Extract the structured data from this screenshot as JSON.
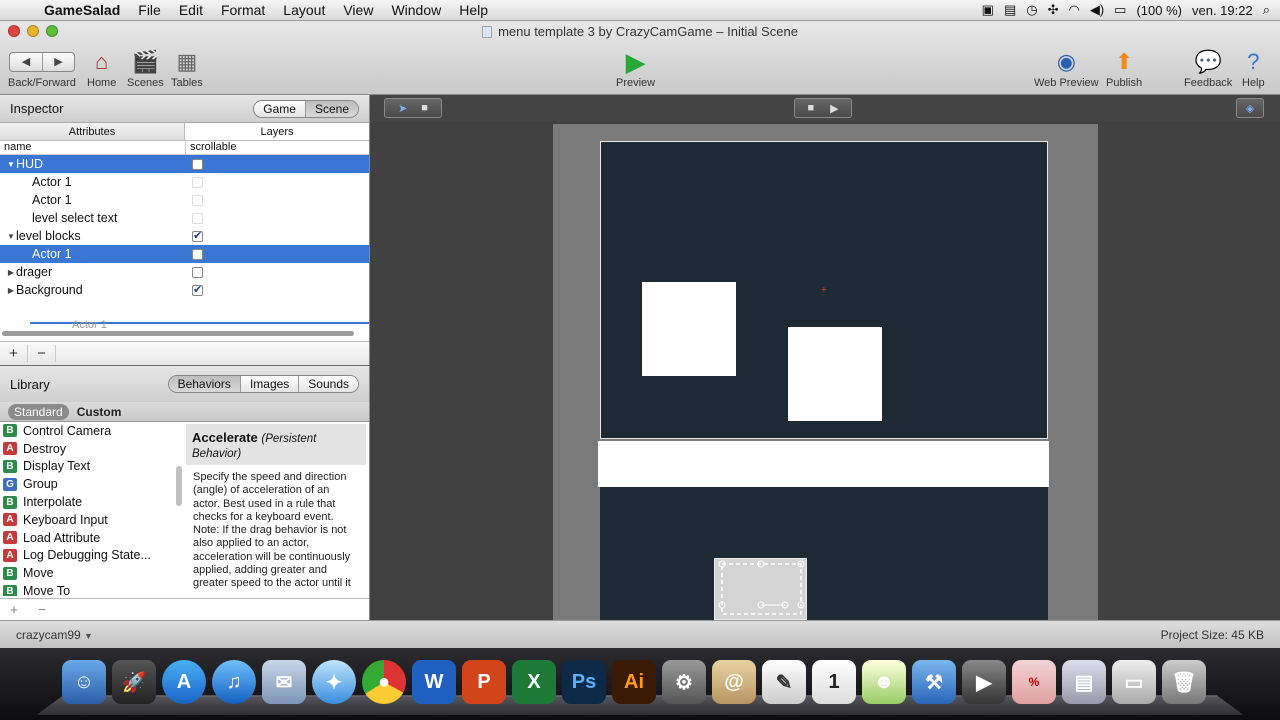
{
  "menubar": {
    "app_name": "GameSalad",
    "items": [
      "File",
      "Edit",
      "Format",
      "Layout",
      "View",
      "Window",
      "Help"
    ],
    "battery": "(100 %)",
    "clock": "ven. 19:22"
  },
  "window": {
    "title": "menu template 3 by CrazyCamGame – Initial Scene"
  },
  "toolbar": {
    "back_forward": "Back/Forward",
    "home": "Home",
    "scenes": "Scenes",
    "tables": "Tables",
    "preview": "Preview",
    "web_preview": "Web Preview",
    "publish": "Publish",
    "feedback": "Feedback",
    "help": "Help"
  },
  "inspector": {
    "title": "Inspector",
    "seg_game": "Game",
    "seg_scene": "Scene",
    "tab_attributes": "Attributes",
    "tab_layers": "Layers",
    "col_name": "name",
    "col_scrollable": "scrollable",
    "rows": [
      {
        "label": "HUD",
        "checked": false,
        "selected": true,
        "expander": "open"
      },
      {
        "label": "Actor 1",
        "checked": false,
        "selected": false,
        "expander": "none"
      },
      {
        "label": "Actor 1",
        "checked": false,
        "selected": false,
        "expander": "none"
      },
      {
        "label": "level select text",
        "checked": false,
        "selected": false,
        "expander": "none"
      },
      {
        "label": "level blocks",
        "checked": true,
        "selected": false,
        "expander": "open"
      },
      {
        "label": "Actor 1",
        "checked": false,
        "selected": true,
        "expander": "none"
      },
      {
        "label": "drager",
        "checked": false,
        "selected": false,
        "expander": "closed"
      },
      {
        "label": "Background",
        "checked": true,
        "selected": false,
        "expander": "closed"
      }
    ],
    "drag_ghost": "Actor 1",
    "add": "+",
    "remove": "−"
  },
  "library": {
    "title": "Library",
    "tab_behaviors": "Behaviors",
    "tab_images": "Images",
    "tab_sounds": "Sounds",
    "sub_standard": "Standard",
    "sub_custom": "Custom",
    "items": [
      {
        "badge": "B",
        "label": "Control Camera"
      },
      {
        "badge": "A",
        "label": "Destroy"
      },
      {
        "badge": "B",
        "label": "Display Text"
      },
      {
        "badge": "G",
        "label": "Group"
      },
      {
        "badge": "B",
        "label": "Interpolate"
      },
      {
        "badge": "A",
        "label": "Keyboard Input"
      },
      {
        "badge": "A",
        "label": "Load Attribute"
      },
      {
        "badge": "A",
        "label": "Log Debugging State..."
      },
      {
        "badge": "B",
        "label": "Move"
      },
      {
        "badge": "B",
        "label": "Move To"
      }
    ],
    "desc_title": "Accelerate",
    "desc_subtitle": "(Persistent Behavior)",
    "desc_body": "Specify the speed and direction (angle) of acceleration of an actor. Best used in a rule that checks for a keyboard event. Note: If the drag behavior is not also applied to an actor, acceleration will be continuously applied, adding greater and greater speed to the actor until it"
  },
  "status": {
    "user": "crazycam99",
    "project_size": "Project Size: 45 KB"
  },
  "colors": {
    "selection": "#3a76d4",
    "scene_bg": "#1d2a33"
  }
}
